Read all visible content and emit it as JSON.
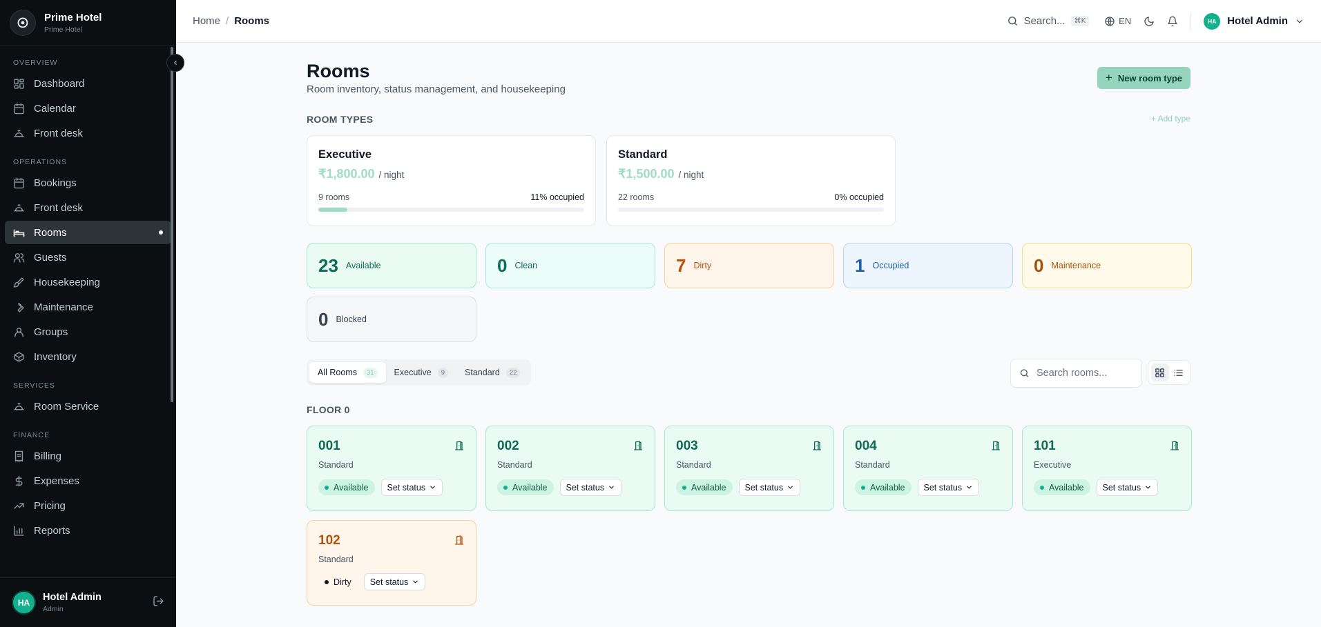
{
  "brand": {
    "name": "Prime Hotel",
    "subtitle": "Prime Hotel"
  },
  "sidebar": {
    "sections": [
      {
        "label": "OVERVIEW",
        "items": [
          {
            "label": "Dashboard",
            "icon": "dashboard-icon"
          },
          {
            "label": "Calendar",
            "icon": "calendar-icon"
          },
          {
            "label": "Front desk",
            "icon": "bell-desk-icon"
          }
        ]
      },
      {
        "label": "OPERATIONS",
        "items": [
          {
            "label": "Bookings",
            "icon": "calendar-icon"
          },
          {
            "label": "Front desk",
            "icon": "bell-desk-icon"
          },
          {
            "label": "Rooms",
            "icon": "bed-icon",
            "active": true
          },
          {
            "label": "Guests",
            "icon": "users-icon"
          },
          {
            "label": "Housekeeping",
            "icon": "brush-icon"
          },
          {
            "label": "Maintenance",
            "icon": "wrench-icon"
          },
          {
            "label": "Groups",
            "icon": "user-icon"
          },
          {
            "label": "Inventory",
            "icon": "box-icon"
          }
        ]
      },
      {
        "label": "SERVICES",
        "items": [
          {
            "label": "Room Service",
            "icon": "bell-desk-icon"
          }
        ]
      },
      {
        "label": "FINANCE",
        "items": [
          {
            "label": "Billing",
            "icon": "receipt-icon"
          },
          {
            "label": "Expenses",
            "icon": "dollar-icon"
          },
          {
            "label": "Pricing",
            "icon": "trend-icon"
          },
          {
            "label": "Reports",
            "icon": "bar-chart-icon"
          }
        ]
      }
    ],
    "footer": {
      "initials": "HA",
      "name": "Hotel Admin",
      "role": "Admin"
    }
  },
  "topbar": {
    "breadcrumb_home": "Home",
    "breadcrumb_sep": "/",
    "breadcrumb_current": "Rooms",
    "search_label": "Search...",
    "search_shortcut": "⌘K",
    "language": "EN",
    "user_initials": "HA",
    "user_name": "Hotel Admin"
  },
  "page": {
    "title": "Rooms",
    "subtitle": "Room inventory, status management, and housekeeping",
    "new_button": "New room type",
    "room_types_label": "ROOM TYPES",
    "add_type_link": "+ Add type"
  },
  "room_types": [
    {
      "name": "Executive",
      "price": "₹1,800.00",
      "per": "/ night",
      "rooms": "9 rooms",
      "occupied": "11% occupied",
      "occupancy": 0.11
    },
    {
      "name": "Standard",
      "price": "₹1,500.00",
      "per": "/ night",
      "rooms": "22 rooms",
      "occupied": "0% occupied",
      "occupancy": 0
    }
  ],
  "stats": [
    {
      "value": "23",
      "label": "Available",
      "bg": "#eafbf3",
      "border": "#a6e9ca",
      "color": "#0f6b54"
    },
    {
      "value": "0",
      "label": "Clean",
      "bg": "#ecfcf8",
      "border": "#a5e8d9",
      "color": "#0f6b5c"
    },
    {
      "value": "7",
      "label": "Dirty",
      "bg": "#fff5eb",
      "border": "#f8cfa1",
      "color": "#b45309"
    },
    {
      "value": "1",
      "label": "Occupied",
      "bg": "#edf5fe",
      "border": "#b4d4f5",
      "color": "#1d5fa8"
    },
    {
      "value": "0",
      "label": "Maintenance",
      "bg": "#fffaea",
      "border": "#f5dc8d",
      "color": "#a3520c"
    },
    {
      "value": "0",
      "label": "Blocked",
      "bg": "#f5f6f7",
      "border": "#dcdfe3",
      "color": "#374151"
    }
  ],
  "tabs": [
    {
      "label": "All Rooms",
      "count": "31",
      "active": true
    },
    {
      "label": "Executive",
      "count": "9"
    },
    {
      "label": "Standard",
      "count": "22"
    }
  ],
  "room_search_placeholder": "Search rooms...",
  "floor_label": "FLOOR 0",
  "set_status_label": "Set status",
  "rooms": [
    {
      "number": "001",
      "type": "Standard",
      "status": "Available",
      "state": "available"
    },
    {
      "number": "002",
      "type": "Standard",
      "status": "Available",
      "state": "available"
    },
    {
      "number": "003",
      "type": "Standard",
      "status": "Available",
      "state": "available"
    },
    {
      "number": "004",
      "type": "Standard",
      "status": "Available",
      "state": "available"
    },
    {
      "number": "101",
      "type": "Executive",
      "status": "Available",
      "state": "available"
    },
    {
      "number": "102",
      "type": "Standard",
      "status": "Dirty",
      "state": "dirty"
    }
  ]
}
